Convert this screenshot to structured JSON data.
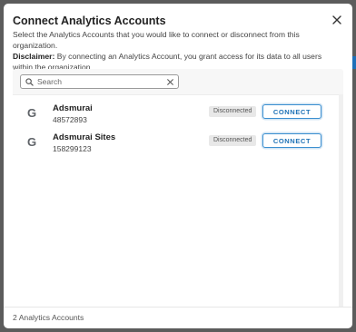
{
  "modal": {
    "title": "Connect Analytics Accounts",
    "description": "Select the Analytics Accounts that you would like to connect or disconnect from this organization.",
    "disclaimer_label": "Disclaimer:",
    "disclaimer_text": " By connecting an Analytics Account, you grant access for its data to all users within the organization.",
    "close_icon": "close-icon"
  },
  "search": {
    "placeholder": "Search",
    "value": "",
    "icon": "search-icon",
    "clear_icon": "clear-icon"
  },
  "accounts": [
    {
      "icon": "google-icon",
      "icon_glyph": "G",
      "name": "Adsmurai",
      "id": "48572893",
      "status": "Disconnected",
      "action": "CONNECT"
    },
    {
      "icon": "google-icon",
      "icon_glyph": "G",
      "name": "Adsmurai Sites",
      "id": "158299123",
      "status": "Disconnected",
      "action": "CONNECT"
    }
  ],
  "footer": {
    "count_text": "2 Analytics Accounts"
  },
  "colors": {
    "accent": "#1f73b7",
    "badge_bg": "#e8e8e8",
    "backdrop": "#5c5c5c"
  }
}
